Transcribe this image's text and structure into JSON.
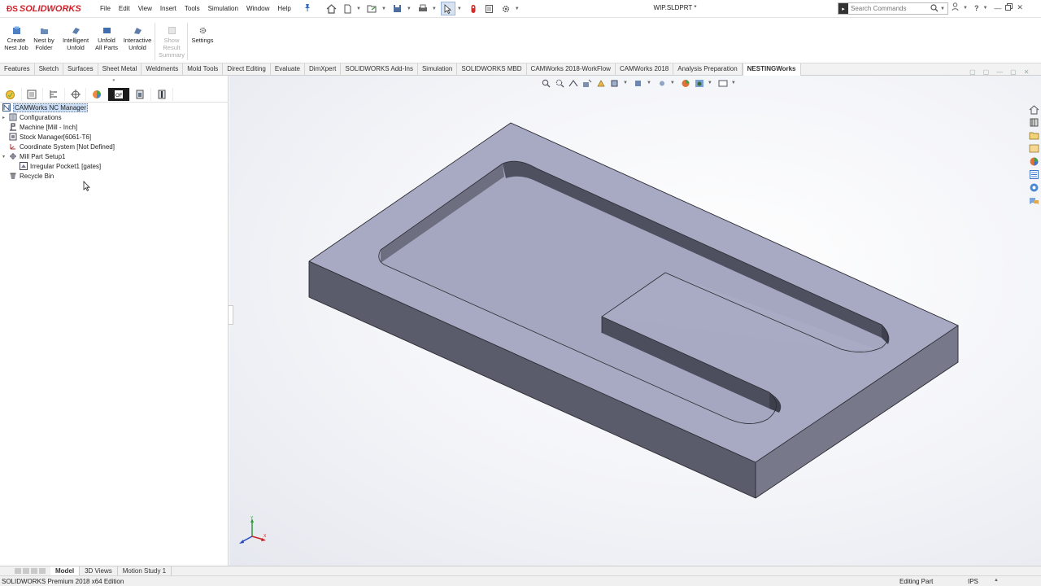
{
  "app": {
    "brand": "SOLIDWORKS",
    "document_title": "WIP.SLDPRT *"
  },
  "menu": [
    "File",
    "Edit",
    "View",
    "Insert",
    "Tools",
    "Simulation",
    "Window",
    "Help"
  ],
  "search": {
    "placeholder": "Search Commands"
  },
  "commands": [
    {
      "label1": "Create",
      "label2": "Nest Job",
      "label3": "",
      "enabled": true
    },
    {
      "label1": "Nest by",
      "label2": "Folder",
      "label3": "",
      "enabled": true
    },
    {
      "label1": "Intelligent",
      "label2": "Unfold",
      "label3": "",
      "enabled": true
    },
    {
      "label1": "Unfold",
      "label2": "All Parts",
      "label3": "",
      "enabled": true
    },
    {
      "label1": "Interactive",
      "label2": "Unfold",
      "label3": "",
      "enabled": true
    },
    {
      "label1": "Show",
      "label2": "Result",
      "label3": "Summary",
      "enabled": false
    },
    {
      "label1": "Settings",
      "label2": "",
      "label3": "",
      "enabled": true
    }
  ],
  "tabs": [
    {
      "label": "Features",
      "active": false
    },
    {
      "label": "Sketch",
      "active": false
    },
    {
      "label": "Surfaces",
      "active": false
    },
    {
      "label": "Sheet Metal",
      "active": false
    },
    {
      "label": "Weldments",
      "active": false
    },
    {
      "label": "Mold Tools",
      "active": false
    },
    {
      "label": "Direct Editing",
      "active": false
    },
    {
      "label": "Evaluate",
      "active": false
    },
    {
      "label": "DimXpert",
      "active": false
    },
    {
      "label": "SOLIDWORKS Add-Ins",
      "active": false
    },
    {
      "label": "Simulation",
      "active": false
    },
    {
      "label": "SOLIDWORKS MBD",
      "active": false
    },
    {
      "label": "CAMWorks 2018-WorkFlow",
      "active": false
    },
    {
      "label": "CAMWorks 2018",
      "active": false
    },
    {
      "label": "Analysis Preparation",
      "active": false
    },
    {
      "label": "NESTINGWorks",
      "active": true
    }
  ],
  "tree": [
    {
      "label": "CAMWorks NC Manager",
      "icon": "nc-manager-icon",
      "selected": true
    },
    {
      "label": "Configurations",
      "icon": "configurations-icon",
      "selected": false
    },
    {
      "label": "Machine [Mill - Inch]",
      "icon": "machine-icon",
      "selected": false
    },
    {
      "label": "Stock Manager[6061-T6]",
      "icon": "stock-manager-icon",
      "selected": false
    },
    {
      "label": "Coordinate System [Not Defined]",
      "icon": "coordinate-system-icon",
      "selected": false
    },
    {
      "label": "Mill Part Setup1",
      "icon": "mill-part-setup-icon",
      "selected": false
    },
    {
      "label": "Irregular Pocket1 [gates]",
      "icon": "irregular-pocket-icon",
      "selected": false
    },
    {
      "label": "Recycle Bin",
      "icon": "recycle-bin-icon",
      "selected": false
    }
  ],
  "bottom_tabs": [
    {
      "label": "Model",
      "active": true
    },
    {
      "label": "3D Views",
      "active": false
    },
    {
      "label": "Motion Study 1",
      "active": false
    }
  ],
  "status": {
    "edition": "SOLIDWORKS Premium 2018 x64 Edition",
    "mode": "Editing Part",
    "units": "IPS"
  },
  "colors": {
    "brand": "#d1202a",
    "part_top": "#a6a8c2",
    "part_front": "#5a5a6a",
    "part_side": "#777789",
    "pocket_floor": "#a4a6c0",
    "pocket_wall": "#4f4f5f"
  }
}
